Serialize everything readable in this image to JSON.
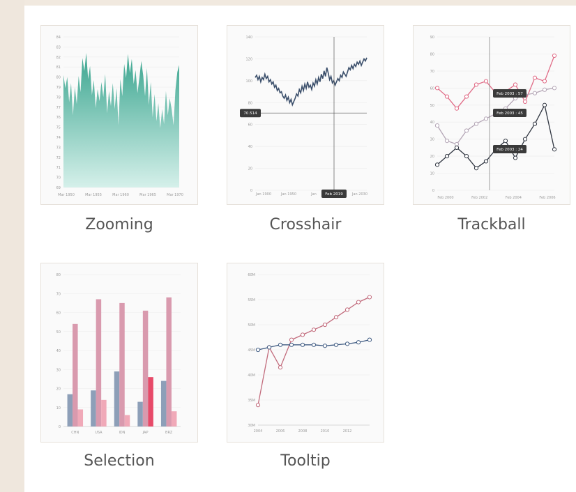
{
  "samples": [
    {
      "id": "zooming",
      "caption": "Zooming",
      "chart_data": {
        "type": "area",
        "title": "",
        "x_ticks": [
          "Mar 1950",
          "Mar 1955",
          "Mar 1960",
          "Mar 1965",
          "Mar 1970"
        ],
        "y_ticks": [
          "69",
          "70",
          "71",
          "72",
          "73",
          "74",
          "75",
          "76",
          "77",
          "78",
          "79",
          "80",
          "81",
          "82",
          "83",
          "84"
        ],
        "ylim": [
          69,
          84
        ],
        "color": "#3aa58f",
        "values": [
          80.2,
          78.9,
          80.0,
          77.5,
          79.4,
          76.2,
          79.0,
          77.3,
          80.1,
          78.5,
          81.9,
          80.6,
          82.4,
          79.8,
          81.1,
          78.2,
          79.7,
          76.9,
          78.8,
          77.6,
          79.5,
          78.0,
          80.3,
          76.4,
          78.6,
          77.1,
          79.4,
          76.8,
          78.9,
          75.2,
          79.8,
          78.1,
          81.3,
          79.9,
          82.3,
          80.4,
          81.8,
          79.3,
          80.7,
          78.4,
          79.9,
          81.6,
          80.2,
          78.1,
          80.9,
          77.2,
          79.5,
          76.0,
          78.3,
          75.6,
          77.4,
          74.9,
          76.8,
          75.3,
          78.6,
          76.2,
          77.9,
          76.8,
          75.2,
          78.7,
          80.5,
          81.2
        ]
      }
    },
    {
      "id": "crosshair",
      "caption": "Crosshair",
      "chart_data": {
        "type": "line",
        "title": "",
        "x_ticks": [
          "Jan 1900",
          "Jan 1950",
          "Jan",
          "Jan 2030"
        ],
        "y_ticks": [
          "0",
          "20",
          "40",
          "60",
          "80",
          "100",
          "120",
          "140"
        ],
        "ylim": [
          0,
          140
        ],
        "color": "#3b4f6b",
        "values": [
          103,
          105,
          101,
          104,
          99,
          103,
          101,
          106,
          102,
          104,
          99,
          101,
          97,
          99,
          94,
          96,
          91,
          93,
          89,
          90,
          86,
          84,
          87,
          82,
          85,
          80,
          83,
          78,
          81,
          84,
          88,
          86,
          92,
          89,
          95,
          91,
          97,
          93,
          99,
          94,
          96,
          92,
          98,
          95,
          101,
          97,
          103,
          99,
          106,
          102,
          109,
          104,
          112,
          107,
          101,
          104,
          98,
          100,
          96,
          99,
          102,
          100,
          105,
          103,
          108,
          106,
          104,
          108,
          112,
          110,
          114,
          111,
          115,
          113,
          117,
          115,
          118,
          114,
          117,
          120,
          118,
          121
        ],
        "crosshair_y_label": "70.514",
        "crosshair_x_label": "Feb 2019"
      }
    },
    {
      "id": "trackball",
      "caption": "Trackball",
      "chart_data": {
        "type": "line",
        "title": "",
        "x_ticks": [
          "Feb 2000",
          "Feb 2002",
          "Feb 2004",
          "Feb 2006"
        ],
        "y_ticks": [
          "0",
          "10",
          "20",
          "30",
          "40",
          "50",
          "60",
          "70",
          "80",
          "90"
        ],
        "ylim": [
          0,
          90
        ],
        "series": [
          {
            "color": "#e06b86",
            "values": [
              60,
              55,
              48,
              55,
              62,
              64,
              57,
              58,
              62,
              52,
              66,
              64,
              79
            ]
          },
          {
            "color": "#b4a6b6",
            "values": [
              38,
              29,
              27,
              35,
              39,
              42,
              45,
              48,
              54,
              56,
              57,
              59,
              60
            ]
          },
          {
            "color": "#2f3540",
            "values": [
              15,
              20,
              25,
              20,
              13,
              17,
              24,
              29,
              19,
              30,
              39,
              50,
              24
            ]
          }
        ],
        "tooltips": [
          "Feb 2003 : 57",
          "Feb 2003 : 45",
          "Feb 2003 : 24"
        ]
      }
    },
    {
      "id": "selection",
      "caption": "Selection",
      "chart_data": {
        "type": "bar",
        "title": "",
        "categories": [
          "CHN",
          "USA",
          "IDN",
          "JAP",
          "BRZ"
        ],
        "y_ticks": [
          "0",
          "10",
          "20",
          "30",
          "40",
          "50",
          "60",
          "70",
          "80"
        ],
        "ylim": [
          0,
          80
        ],
        "series": [
          {
            "color": "#8d9fb8",
            "values": [
              17,
              19,
              29,
              13,
              24
            ]
          },
          {
            "color": "#d99aae",
            "values": [
              54,
              67,
              65,
              61,
              68
            ]
          },
          {
            "color": "#f0a9b8",
            "values": [
              9,
              14,
              6,
              26,
              8
            ]
          }
        ],
        "selected": {
          "series": 2,
          "index": 3,
          "color": "#e74a69"
        }
      }
    },
    {
      "id": "tooltip",
      "caption": "Tooltip",
      "chart_data": {
        "type": "line",
        "title": "",
        "x": [
          2004,
          2005,
          2006,
          2007,
          2008,
          2009,
          2010,
          2011,
          2012,
          2013,
          2014
        ],
        "x_ticks": [
          "2004",
          "2006",
          "2008",
          "2010",
          "2012"
        ],
        "y_ticks": [
          "30M",
          "35M",
          "40M",
          "45M",
          "50M",
          "55M",
          "60M"
        ],
        "ylim": [
          30,
          60
        ],
        "series": [
          {
            "color": "#c26b7c",
            "values": [
              34,
              45.5,
              41.5,
              47,
              48,
              49,
              50,
              51.5,
              53,
              54.5,
              55.5
            ]
          },
          {
            "color": "#3f5b82",
            "values": [
              45,
              45.5,
              46,
              46,
              46,
              46,
              45.8,
              46,
              46.2,
              46.5,
              47
            ]
          }
        ]
      }
    }
  ]
}
